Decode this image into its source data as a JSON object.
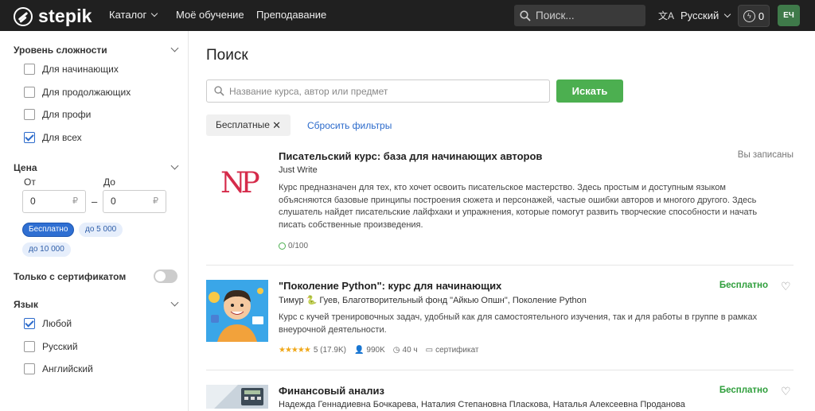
{
  "topbar": {
    "logo": "stepik",
    "nav": {
      "catalog": "Каталог",
      "learning": "Моё обучение",
      "teaching": "Преподавание"
    },
    "search_placeholder": "Поиск...",
    "language": "Русский",
    "points": "0",
    "avatar_initials": "ЕЧ"
  },
  "sidebar": {
    "difficulty": {
      "title": "Уровень сложности",
      "options": [
        {
          "label": "Для начинающих",
          "checked": false
        },
        {
          "label": "Для продолжающих",
          "checked": false
        },
        {
          "label": "Для профи",
          "checked": false
        },
        {
          "label": "Для всех",
          "checked": true
        }
      ]
    },
    "price": {
      "title": "Цена",
      "from_label": "От",
      "to_label": "До",
      "from_value": "0",
      "to_value": "0",
      "currency": "₽",
      "dash": "–",
      "chips": [
        {
          "label": "Бесплатно",
          "active": true
        },
        {
          "label": "до 5 000",
          "active": false
        },
        {
          "label": "до 10 000",
          "active": false
        }
      ]
    },
    "certificate": {
      "label": "Только с сертификатом",
      "enabled": false
    },
    "language": {
      "title": "Язык",
      "options": [
        {
          "label": "Любой",
          "checked": true
        },
        {
          "label": "Русский",
          "checked": false
        },
        {
          "label": "Английский",
          "checked": false
        }
      ]
    }
  },
  "main": {
    "title": "Поиск",
    "search_placeholder": "Название курса, автор или предмет",
    "search_button": "Искать",
    "active_filter": "Бесплатные",
    "reset_filters": "Сбросить фильтры",
    "courses": [
      {
        "title": "Писательский курс: база для начинающих авторов",
        "author": "Just Write",
        "description": "Курс предназначен для тех, кто хочет освоить писательское мастерство. Здесь простым и доступным языком объясняются базовые принципы построения сюжета и персонажей, частые ошибки авторов и многого другого. Здесь слушатель найдет писательские лайфхаки и упражнения, которые помогут развить творческие способности и начать писать собственные произведения.",
        "status": "Вы записаны",
        "progress": "0/100",
        "logo_text": "NP"
      },
      {
        "title": "\"Поколение Python\": курс для начинающих",
        "author": "Тимур 🐍 Гуев, Благотворительный фонд \"Айкью Опшн\", Поколение Python",
        "description": "Курс с кучей тренировочных задач, удобный как для самостоятельного изучения, так и для работы в группе в рамках внеурочной деятельности.",
        "price": "Бесплатно",
        "rating_stars": "★★★★★",
        "rating": "5 (17.9K)",
        "learners": "990K",
        "duration": "40 ч",
        "certificate": "сертификат"
      },
      {
        "title": "Финансовый анализ",
        "author": "Надежда Геннадиевна Бочкарева, Наталия Степановна Пласкова, Наталья Алексеевна Проданова",
        "price": "Бесплатно"
      }
    ]
  },
  "colors": {
    "topbar": "#202020",
    "accent_green": "#4caf50",
    "link_blue": "#2b6acb",
    "free_green": "#2e9e3b"
  }
}
